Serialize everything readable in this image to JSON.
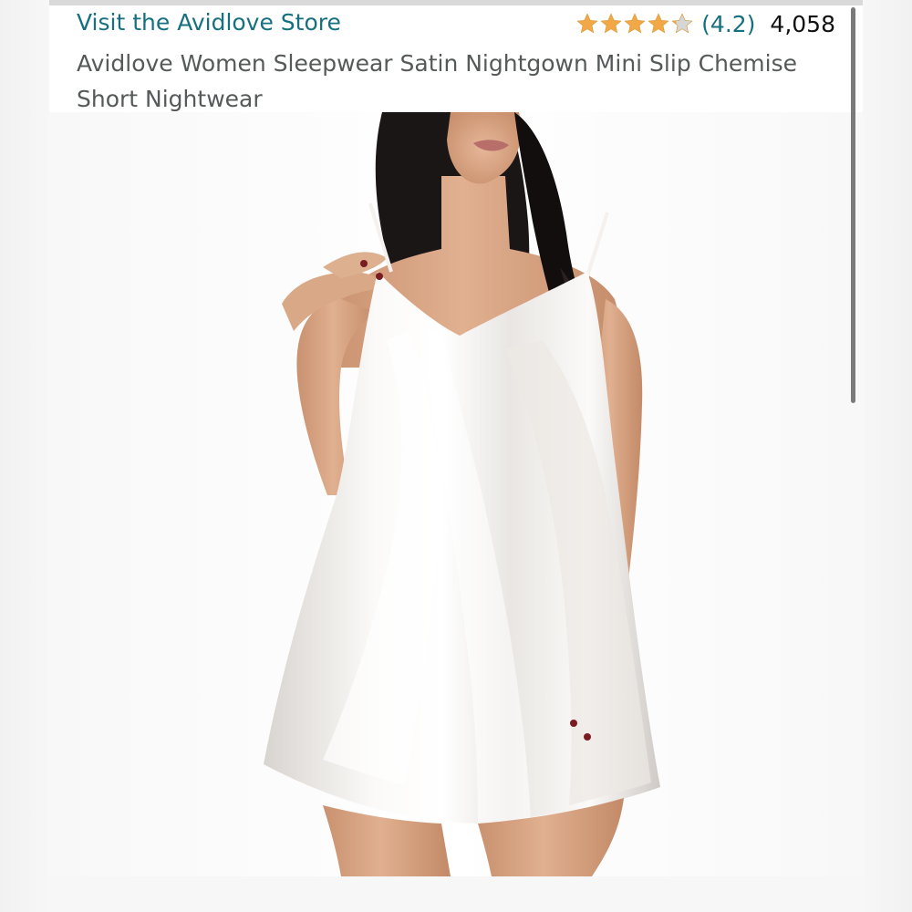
{
  "store": {
    "link_label": "Visit the Avidlove Store"
  },
  "rating": {
    "stars": 4.2,
    "value_label": "(4.2)",
    "review_count": "4,058",
    "star_color": "#f3a847",
    "empty_star_color": "#d6d6d6"
  },
  "product": {
    "title": "Avidlove Women Sleepwear Satin Nightgown Mini Slip Chemise Short Nightwear"
  },
  "colors": {
    "link": "#17707f",
    "title_text": "#565959"
  },
  "icons": {
    "star": "star-icon",
    "scrollbar": "scrollbar"
  }
}
